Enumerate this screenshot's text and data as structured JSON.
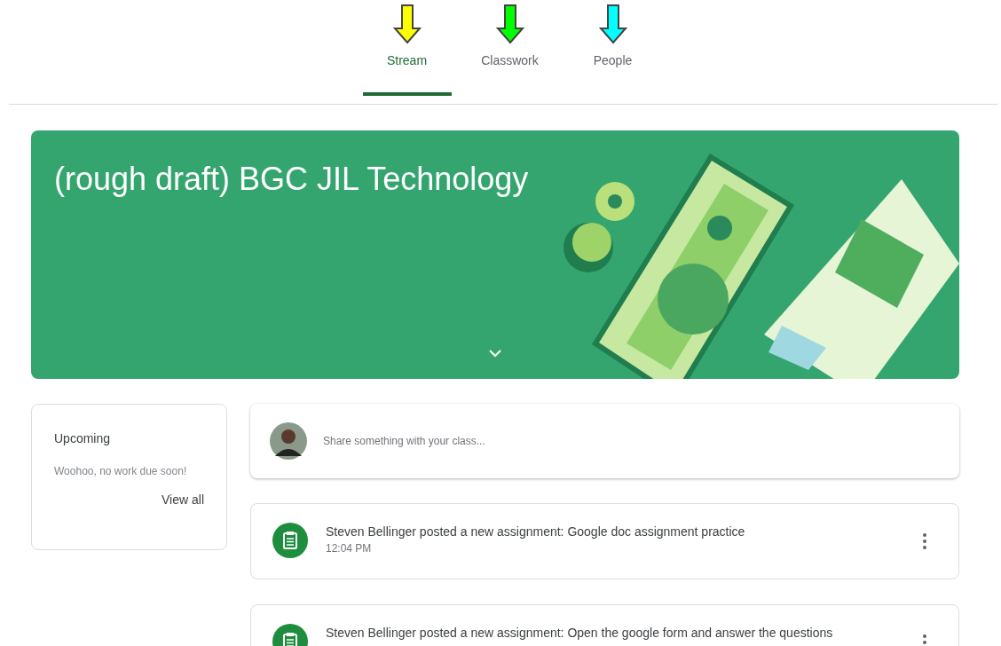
{
  "tabs": [
    {
      "label": "Stream",
      "selected": true,
      "color": "#ffff00"
    },
    {
      "label": "Classwork",
      "selected": false,
      "color": "#00ff00"
    },
    {
      "label": "People",
      "selected": false,
      "color": "#00ffff"
    }
  ],
  "banner": {
    "title": "(rough draft) BGC JIL Technology"
  },
  "upcoming": {
    "title": "Upcoming",
    "message": "Woohoo, no work due soon!",
    "link": "View all"
  },
  "share": {
    "placeholder": "Share something with your class..."
  },
  "posts": [
    {
      "text": "Steven Bellinger posted a new assignment: Google doc assignment practice",
      "time": "12:04 PM"
    },
    {
      "text": "Steven Bellinger posted a new assignment: Open the google form and answer the questions"
    }
  ]
}
